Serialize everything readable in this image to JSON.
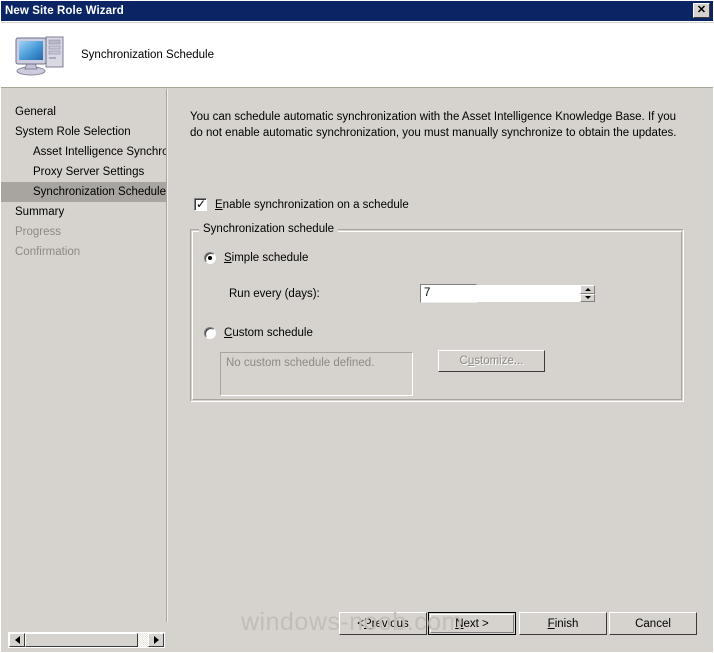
{
  "window": {
    "title": "New Site Role Wizard",
    "close_label": "✕"
  },
  "header": {
    "page_title": "Synchronization Schedule",
    "icon": "computer-server-icon"
  },
  "sidebar": {
    "items": [
      {
        "label": "General",
        "indent": false,
        "state": "normal"
      },
      {
        "label": "System Role Selection",
        "indent": false,
        "state": "normal"
      },
      {
        "label": "Asset Intelligence Synchron",
        "indent": true,
        "state": "normal"
      },
      {
        "label": "Proxy Server Settings",
        "indent": true,
        "state": "normal"
      },
      {
        "label": "Synchronization Schedule",
        "indent": true,
        "state": "selected"
      },
      {
        "label": "Summary",
        "indent": false,
        "state": "normal"
      },
      {
        "label": "Progress",
        "indent": false,
        "state": "disabled"
      },
      {
        "label": "Confirmation",
        "indent": false,
        "state": "disabled"
      }
    ]
  },
  "content": {
    "description": "You can schedule automatic synchronization with the Asset Intelligence Knowledge Base. If you do not enable automatic synchronization, you must manually synchronize to obtain the updates.",
    "enable_checkbox": {
      "label_accel": "E",
      "label_rest": "nable synchronization on a schedule",
      "checked": true
    },
    "groupbox": {
      "legend": "Synchronization schedule",
      "simple_radio": {
        "label_accel": "S",
        "label_rest": "imple schedule",
        "selected": true
      },
      "run_every_label": "Run every (days):",
      "run_every_value": "7",
      "custom_radio": {
        "label_accel": "C",
        "label_rest": "ustom schedule",
        "selected": false
      },
      "custom_textbox_value": "No custom schedule defined.",
      "customize_button": {
        "label_pre": "C",
        "label_accel": "u",
        "label_rest": "stomize...",
        "disabled": true
      }
    }
  },
  "footer": {
    "previous_pre": "< ",
    "previous_accel": "P",
    "previous_rest": "revious",
    "next_accel": "N",
    "next_rest": "ext >",
    "finish_accel": "F",
    "finish_rest": "inish",
    "cancel_label": "Cancel"
  },
  "watermark": {
    "text": "windows-noob.com"
  },
  "colors": {
    "titlebar": "#0b2464",
    "face": "#d6d3ce",
    "selection": "#a8a5a0",
    "disabled_text": "#8c8984",
    "watermark": "#c2bdb6"
  }
}
